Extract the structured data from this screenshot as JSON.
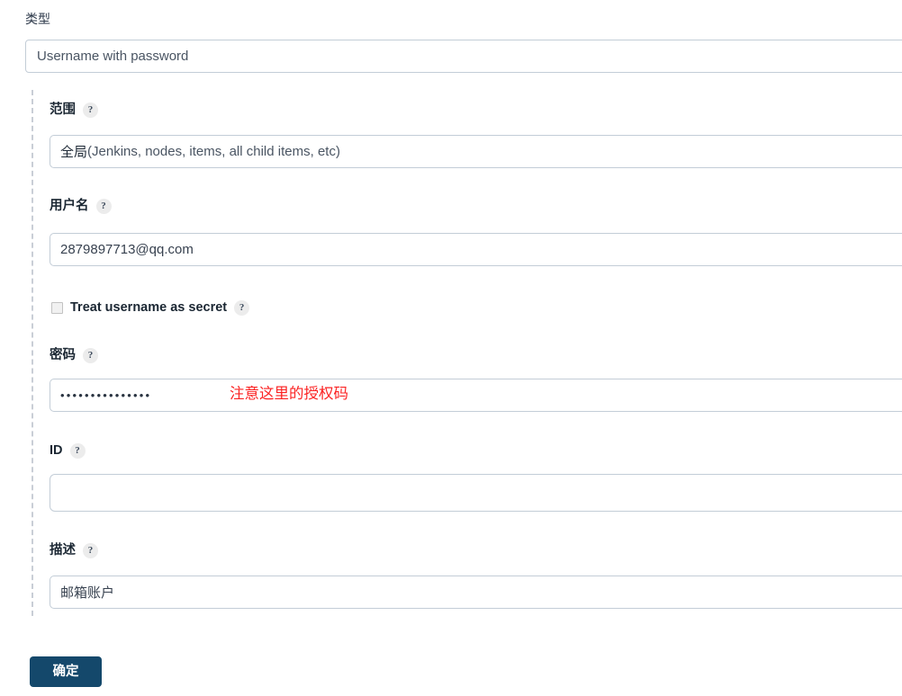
{
  "form": {
    "type_field": {
      "label": "类型",
      "selected": "Username with password"
    },
    "scope_field": {
      "label": "范围",
      "help": "?",
      "value_cn": "全局",
      "value_en": " (Jenkins, nodes, items, all child items, etc)"
    },
    "username_field": {
      "label": "用户名",
      "help": "?",
      "value": "2879897713@qq.com"
    },
    "secret_checkbox": {
      "label": "Treat username as secret",
      "help": "?",
      "checked": false
    },
    "password_field": {
      "label": "密码",
      "help": "?",
      "masked_value": "•••••••••••••••"
    },
    "id_field": {
      "label": "ID",
      "help": "?",
      "value": ""
    },
    "description_field": {
      "label": "描述",
      "help": "?",
      "value": "邮箱账户"
    },
    "submit_button": {
      "label": "确定"
    }
  },
  "annotation": {
    "password_note": "注意这里的授权码",
    "color": "#fb2222"
  },
  "theme": {
    "accent": "#14486b",
    "border": "#c3cdd7",
    "text": "#1b2733",
    "help_bg": "#ececec"
  }
}
